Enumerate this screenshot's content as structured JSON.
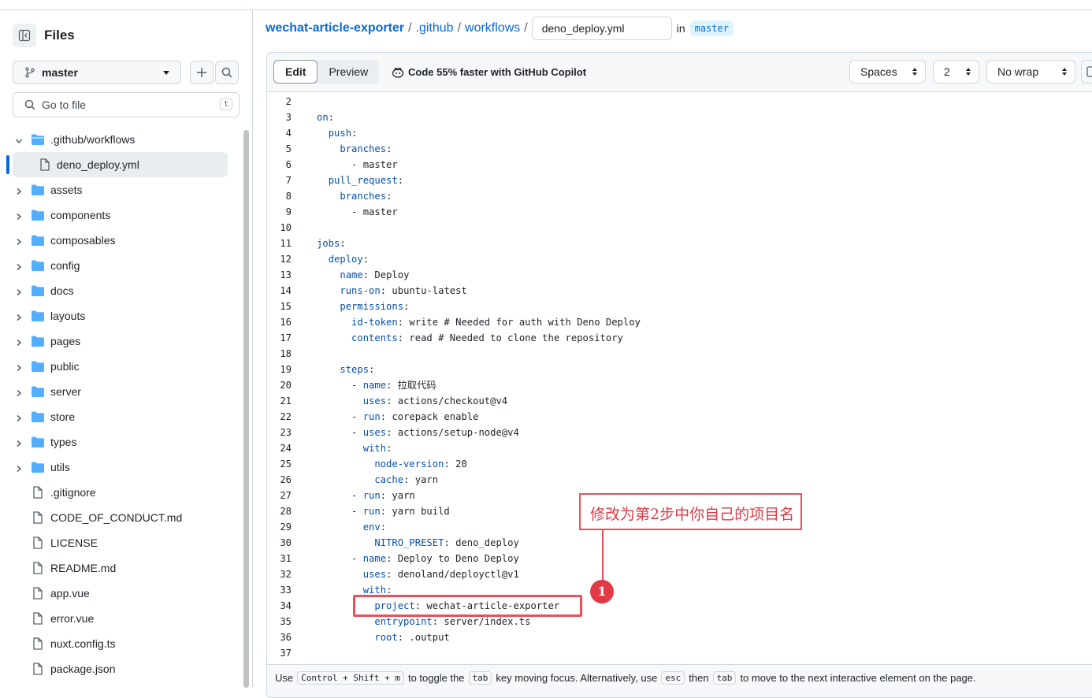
{
  "sidebar": {
    "title": "Files",
    "branch": "master",
    "goto_placeholder": "Go to file",
    "goto_shortcut": "t",
    "tree": [
      {
        "name": ".github/workflows",
        "type": "folder",
        "expanded": true
      },
      {
        "name": "deno_deploy.yml",
        "type": "file",
        "child": true,
        "selected": true
      },
      {
        "name": "assets",
        "type": "folder"
      },
      {
        "name": "components",
        "type": "folder"
      },
      {
        "name": "composables",
        "type": "folder"
      },
      {
        "name": "config",
        "type": "folder"
      },
      {
        "name": "docs",
        "type": "folder"
      },
      {
        "name": "layouts",
        "type": "folder"
      },
      {
        "name": "pages",
        "type": "folder"
      },
      {
        "name": "public",
        "type": "folder"
      },
      {
        "name": "server",
        "type": "folder"
      },
      {
        "name": "store",
        "type": "folder"
      },
      {
        "name": "types",
        "type": "folder"
      },
      {
        "name": "utils",
        "type": "folder"
      },
      {
        "name": ".gitignore",
        "type": "file"
      },
      {
        "name": "CODE_OF_CONDUCT.md",
        "type": "file"
      },
      {
        "name": "LICENSE",
        "type": "file"
      },
      {
        "name": "README.md",
        "type": "file"
      },
      {
        "name": "app.vue",
        "type": "file"
      },
      {
        "name": "error.vue",
        "type": "file"
      },
      {
        "name": "nuxt.config.ts",
        "type": "file"
      },
      {
        "name": "package.json",
        "type": "file"
      }
    ]
  },
  "breadcrumb": {
    "repo": "wechat-article-exporter",
    "dir1": ".github",
    "dir2": "workflows",
    "sep": "/",
    "filename": "deno_deploy.yml",
    "in_text": "in",
    "branch": "master"
  },
  "toolbar": {
    "edit": "Edit",
    "preview": "Preview",
    "copilot": "Code 55% faster with GitHub Copilot",
    "indent_mode": "Spaces",
    "indent_size": "2",
    "wrap_mode": "No wrap"
  },
  "code_lines": [
    {
      "n": "2",
      "text": ""
    },
    {
      "n": "3",
      "text": "on:"
    },
    {
      "n": "4",
      "text": "  push:"
    },
    {
      "n": "5",
      "text": "    branches:"
    },
    {
      "n": "6",
      "text": "      - master"
    },
    {
      "n": "7",
      "text": "  pull_request:"
    },
    {
      "n": "8",
      "text": "    branches:"
    },
    {
      "n": "9",
      "text": "      - master"
    },
    {
      "n": "10",
      "text": ""
    },
    {
      "n": "11",
      "text": "jobs:"
    },
    {
      "n": "12",
      "text": "  deploy:"
    },
    {
      "n": "13",
      "text": "    name: Deploy"
    },
    {
      "n": "14",
      "text": "    runs-on: ubuntu-latest"
    },
    {
      "n": "15",
      "text": "    permissions:"
    },
    {
      "n": "16",
      "text": "      id-token: write # Needed for auth with Deno Deploy"
    },
    {
      "n": "17",
      "text": "      contents: read # Needed to clone the repository"
    },
    {
      "n": "18",
      "text": ""
    },
    {
      "n": "19",
      "text": "    steps:"
    },
    {
      "n": "20",
      "text": "      - name: 拉取代码"
    },
    {
      "n": "21",
      "text": "        uses: actions/checkout@v4"
    },
    {
      "n": "22",
      "text": "      - run: corepack enable"
    },
    {
      "n": "23",
      "text": "      - uses: actions/setup-node@v4"
    },
    {
      "n": "24",
      "text": "        with:"
    },
    {
      "n": "25",
      "text": "          node-version: 20"
    },
    {
      "n": "26",
      "text": "          cache: yarn"
    },
    {
      "n": "27",
      "text": "      - run: yarn"
    },
    {
      "n": "28",
      "text": "      - run: yarn build"
    },
    {
      "n": "29",
      "text": "        env:"
    },
    {
      "n": "30",
      "text": "          NITRO_PRESET: deno_deploy"
    },
    {
      "n": "31",
      "text": "      - name: Deploy to Deno Deploy"
    },
    {
      "n": "32",
      "text": "        uses: denoland/deployctl@v1"
    },
    {
      "n": "33",
      "text": "        with:"
    },
    {
      "n": "34",
      "text": "          project: wechat-article-exporter"
    },
    {
      "n": "35",
      "text": "          entrypoint: server/index.ts"
    },
    {
      "n": "36",
      "text": "          root: .output"
    },
    {
      "n": "37",
      "text": ""
    }
  ],
  "footer": {
    "t1": "Use",
    "k1": "Control + Shift + m",
    "t2": "to toggle the",
    "k2": "tab",
    "t3": "key moving focus. Alternatively, use",
    "k3": "esc",
    "t4": "then",
    "k4": "tab",
    "t5": "to move to the next interactive element on the page."
  },
  "annotation": {
    "text": "修改为第2步中你自己的项目名",
    "marker": "1"
  },
  "colors": {
    "link": "#0969da",
    "yaml_key": "#0550ae",
    "annotation_red": "#e8505b",
    "folder": "#54aeff"
  }
}
